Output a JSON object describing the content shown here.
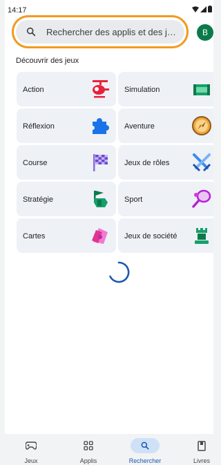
{
  "status_bar": {
    "time": "14:17",
    "icons": [
      "wifi-icon",
      "signal-icon",
      "battery-icon"
    ]
  },
  "search": {
    "placeholder": "Rechercher des applis et des je..."
  },
  "account": {
    "avatar_letter": "B",
    "avatar_color": "#0b7a4b"
  },
  "discover": {
    "title": "Découvrir des jeux",
    "categories": [
      {
        "label": "Action",
        "icon": "helicopter-icon"
      },
      {
        "label": "Simulation",
        "icon": "stadium-icon"
      },
      {
        "label": "Réflexion",
        "icon": "puzzle-piece-icon"
      },
      {
        "label": "Aventure",
        "icon": "compass-icon"
      },
      {
        "label": "Course",
        "icon": "checkered-flag-icon"
      },
      {
        "label": "Jeux de rôles",
        "icon": "crossed-swords-icon"
      },
      {
        "label": "Stratégie",
        "icon": "strategy-flag-icon"
      },
      {
        "label": "Sport",
        "icon": "tennis-racket-icon"
      },
      {
        "label": "Cartes",
        "icon": "cards-icon"
      },
      {
        "label": "Jeux de société",
        "icon": "chess-rook-icon"
      }
    ]
  },
  "loading_indicator": "spinner-icon",
  "bottom_nav": {
    "items": [
      {
        "label": "Jeux",
        "icon": "gamepad-icon",
        "active": false
      },
      {
        "label": "Applis",
        "icon": "apps-grid-icon",
        "active": false
      },
      {
        "label": "Rechercher",
        "icon": "search-icon",
        "active": true
      },
      {
        "label": "Livres",
        "icon": "book-icon",
        "active": false
      }
    ]
  },
  "colors": {
    "highlight_ring": "#f29a1f",
    "active_nav": "#1a56b0",
    "spinner": "#1a56b0"
  }
}
